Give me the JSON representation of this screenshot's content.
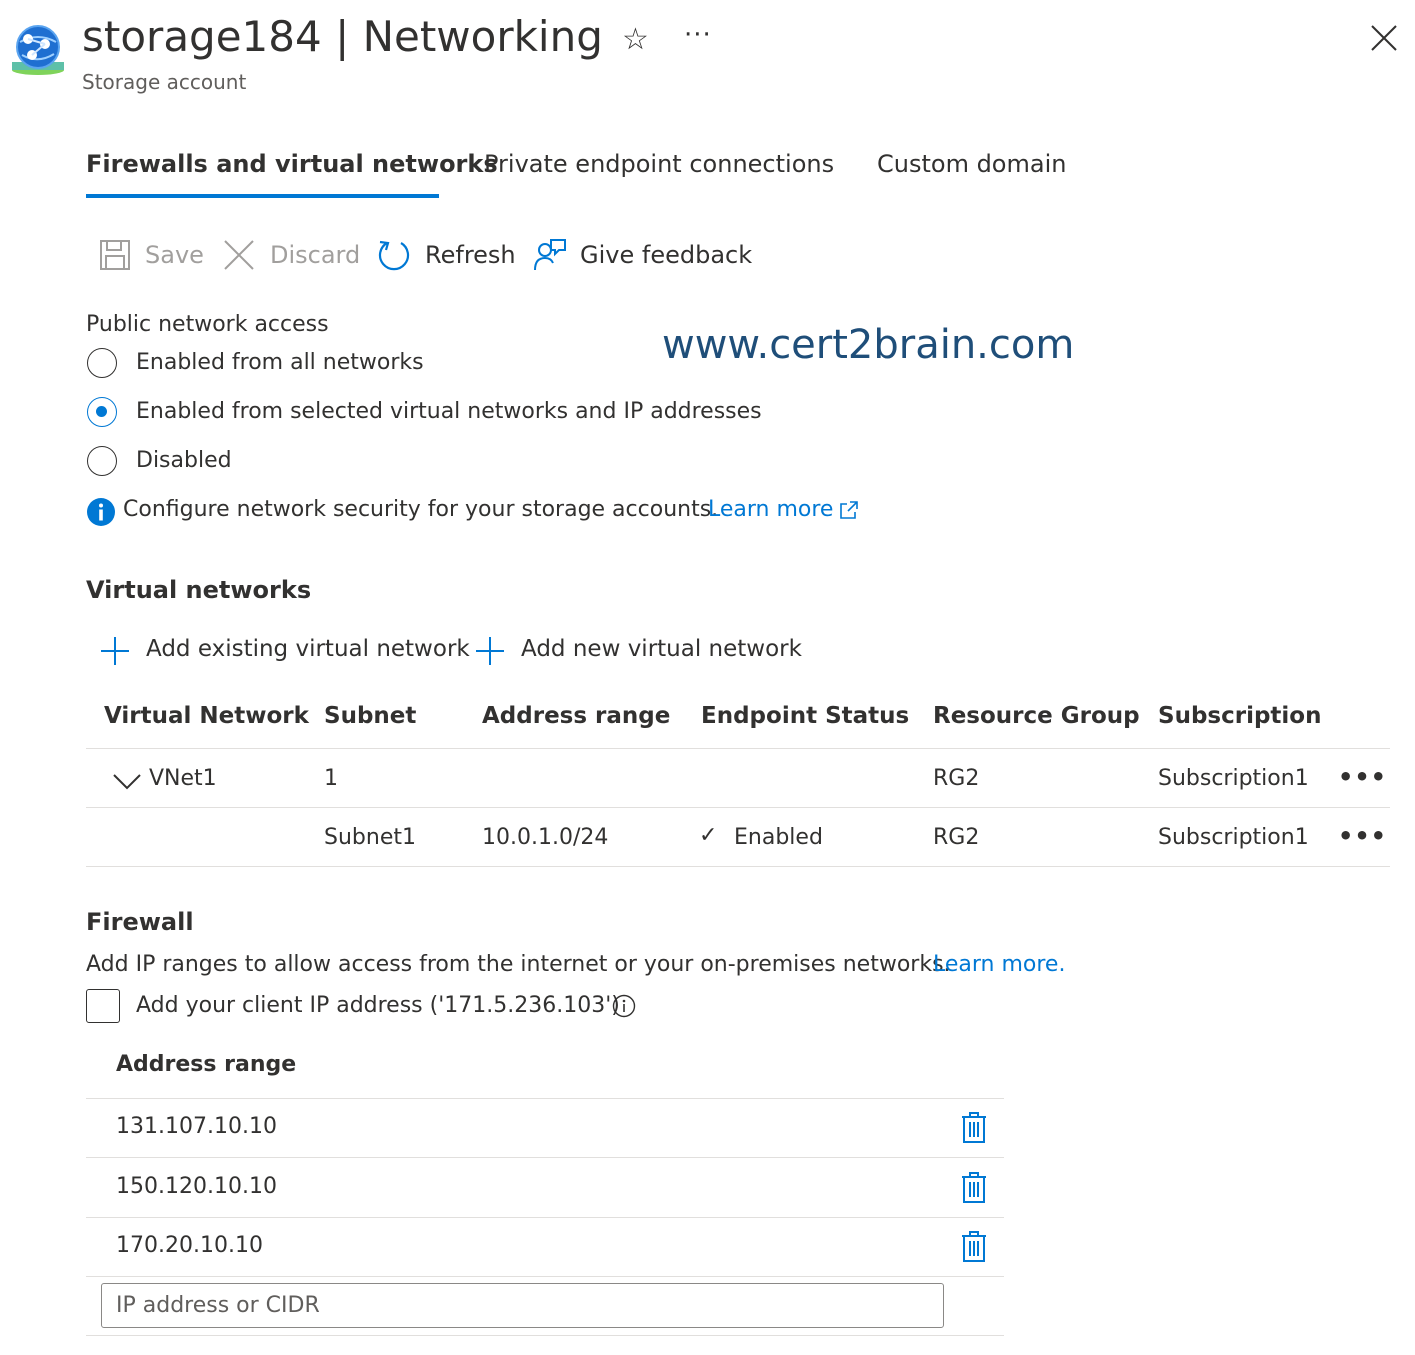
{
  "header": {
    "title": "storage184 | Networking",
    "subtitle": "Storage account",
    "star_glyph": "☆",
    "more_glyph": "···"
  },
  "tabs": [
    {
      "label": "Firewalls and virtual networks",
      "active": true
    },
    {
      "label": "Private endpoint connections",
      "active": false
    },
    {
      "label": "Custom domain",
      "active": false
    }
  ],
  "toolbar": {
    "save_label": "Save",
    "discard_label": "Discard",
    "refresh_label": "Refresh",
    "feedback_label": "Give feedback"
  },
  "public_network_access": {
    "label": "Public network access",
    "options": [
      {
        "label": "Enabled from all networks",
        "selected": false
      },
      {
        "label": "Enabled from selected virtual networks and IP addresses",
        "selected": true
      },
      {
        "label": "Disabled",
        "selected": false
      }
    ],
    "info_text": "Configure network security for your storage accounts.",
    "learn_more": "Learn more"
  },
  "watermark": "www.cert2brain.com",
  "virtual_networks": {
    "heading": "Virtual networks",
    "add_existing": "Add existing virtual network",
    "add_new": "Add new virtual network",
    "columns": [
      "Virtual Network",
      "Subnet",
      "Address range",
      "Endpoint Status",
      "Resource Group",
      "Subscription"
    ],
    "rows": [
      {
        "vnet": "VNet1",
        "subnet": "1",
        "range": "",
        "status": "",
        "rg": "RG2",
        "subscription": "Subscription1"
      },
      {
        "vnet": "",
        "subnet": "Subnet1",
        "range": "10.0.1.0/24",
        "status": "Enabled",
        "rg": "RG2",
        "subscription": "Subscription1"
      }
    ],
    "row_more_glyph": "•••",
    "check_glyph": "✓"
  },
  "firewall": {
    "heading": "Firewall",
    "description": "Add IP ranges to allow access from the internet or your on-premises networks.",
    "learn_more": "Learn more.",
    "client_ip_label": "Add your client IP address ('171.5.236.103')",
    "client_ip_checked": false,
    "address_range_header": "Address range",
    "ranges": [
      "131.107.10.10",
      "150.120.10.10",
      "170.20.10.10"
    ],
    "input_placeholder": "IP address or CIDR",
    "input_value": ""
  },
  "colors": {
    "accent": "#0078d4",
    "text": "#323130",
    "disabled": "#a19f9d",
    "divider": "#e1dfdd",
    "watermark": "#1f4e79"
  },
  "icons": {
    "logo": "storage-account-icon",
    "close": "close-icon",
    "save": "save-icon",
    "discard": "discard-icon",
    "refresh": "refresh-icon",
    "feedback": "feedback-icon",
    "info": "info-icon",
    "external": "external-link-icon",
    "add": "plus-icon",
    "expand": "chevron-down-icon",
    "delete": "trash-icon"
  }
}
